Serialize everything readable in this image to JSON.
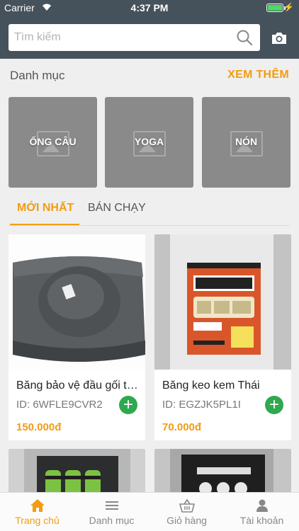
{
  "status_bar": {
    "carrier": "Carrier",
    "time": "4:37 PM"
  },
  "search": {
    "placeholder": "Tìm kiếm"
  },
  "categories_section": {
    "title": "Danh mục",
    "see_more": "XEM THÊM",
    "items": [
      {
        "label": "ỐNG CÂU"
      },
      {
        "label": "YOGA"
      },
      {
        "label": "NÓN"
      }
    ]
  },
  "tabs": {
    "newest": "MỚI NHẤT",
    "best_selling": "BÁN CHẠY",
    "active": "newest"
  },
  "products": [
    {
      "name": "Băng bảo vệ đầu gối thể thao",
      "id_text": "ID: 6WFLE9CVR2",
      "price": "150.000đ"
    },
    {
      "name": "Băng keo kem Thái",
      "id_text": "ID: EGZJK5PL1I",
      "price": "70.000đ"
    },
    {
      "name": ""
    },
    {
      "name": ""
    }
  ],
  "tab_bar": {
    "items": [
      {
        "label": "Trang chủ",
        "icon": "home-icon",
        "active": true
      },
      {
        "label": "Danh mục",
        "icon": "menu-icon",
        "active": false
      },
      {
        "label": "Giỏ hàng",
        "icon": "basket-icon",
        "active": false
      },
      {
        "label": "Tài khoản",
        "icon": "user-icon",
        "active": false
      }
    ]
  },
  "colors": {
    "accent": "#f39c12",
    "header": "#46525b",
    "add_button": "#2fa84f",
    "battery": "#4cd964"
  }
}
